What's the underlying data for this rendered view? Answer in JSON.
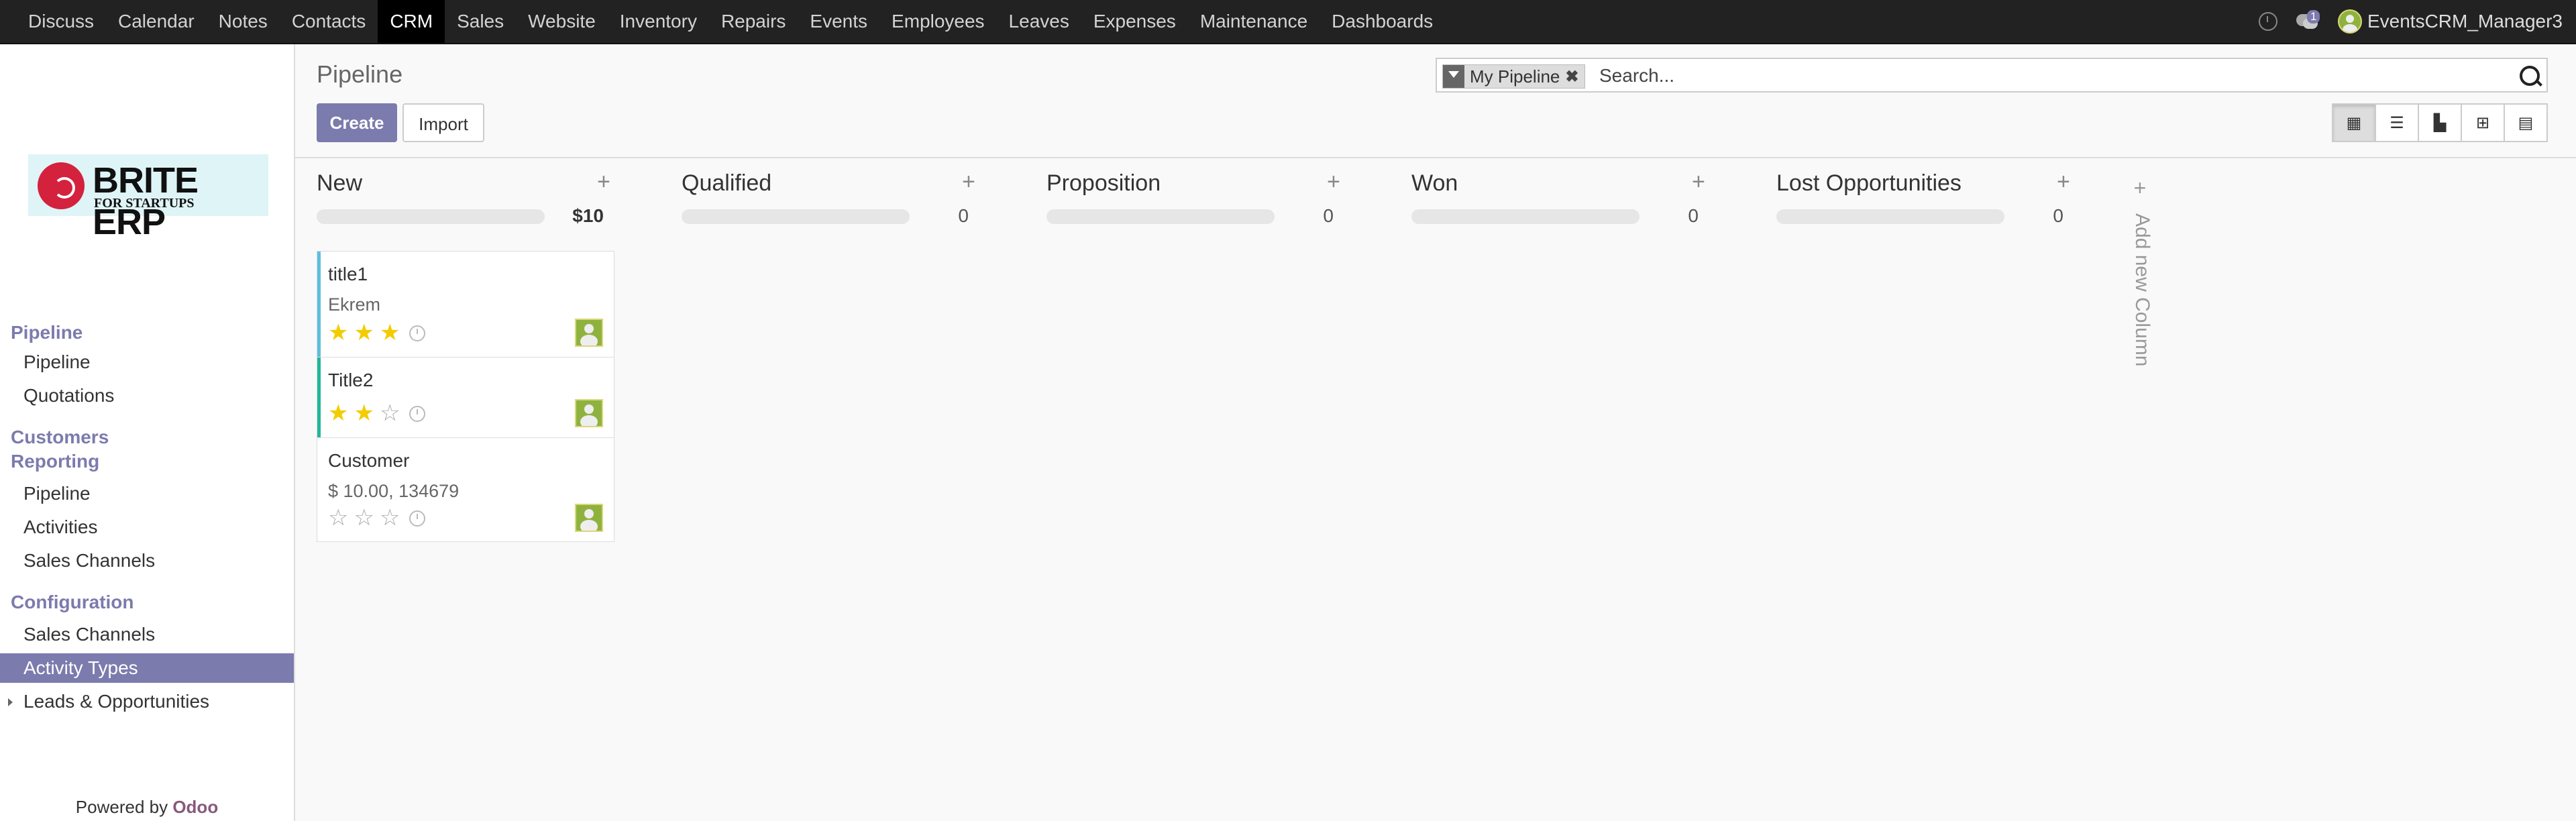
{
  "topbar": {
    "menu": [
      "Discuss",
      "Calendar",
      "Notes",
      "Contacts",
      "CRM",
      "Sales",
      "Website",
      "Inventory",
      "Repairs",
      "Events",
      "Employees",
      "Leaves",
      "Expenses",
      "Maintenance",
      "Dashboards"
    ],
    "active": "CRM",
    "message_count": "1",
    "user": "EventsCRM_Manager3"
  },
  "logo": {
    "title": "BRITE ERP",
    "subtitle": "FOR STARTUPS"
  },
  "sidebar": {
    "sections": [
      {
        "title": "Pipeline",
        "items": [
          "Pipeline",
          "Quotations"
        ]
      },
      {
        "title": "Customers",
        "items": []
      },
      {
        "title": "Reporting",
        "items": [
          "Pipeline",
          "Activities",
          "Sales Channels"
        ]
      },
      {
        "title": "Configuration",
        "items": [
          "Sales Channels",
          "Activity Types",
          "Leads & Opportunities"
        ]
      }
    ],
    "active_item": "Activity Types",
    "powered_by": "Powered by",
    "powered_brand": "Odoo"
  },
  "control": {
    "breadcrumb": "Pipeline",
    "create_label": "Create",
    "import_label": "Import",
    "facet": "My Pipeline",
    "search_placeholder": "Search...",
    "views": [
      "kanban-view-icon",
      "list-view-icon",
      "graph-view-icon",
      "pivot-view-icon",
      "calendar-view-icon"
    ],
    "active_view": "kanban"
  },
  "kanban": {
    "columns": [
      {
        "title": "New",
        "total": "$10"
      },
      {
        "title": "Qualified",
        "total": "0"
      },
      {
        "title": "Proposition",
        "total": "0"
      },
      {
        "title": "Won",
        "total": "0"
      },
      {
        "title": "Lost Opportunities",
        "total": "0"
      }
    ],
    "cards": [
      {
        "title": "title1",
        "subtitle": "Ekrem",
        "stars": 3,
        "stripe": "#5bc0de"
      },
      {
        "title": "Title2",
        "subtitle": "",
        "stars": 2,
        "stripe": "#21b799"
      },
      {
        "title": "Customer",
        "subtitle": "$ 10.00, 134679",
        "stars": 0,
        "stripe": ""
      }
    ],
    "add_column": "Add new Column"
  },
  "colors": {
    "brand": "#7c7bad",
    "topbar": "#222222",
    "star": "#f3cc00"
  }
}
